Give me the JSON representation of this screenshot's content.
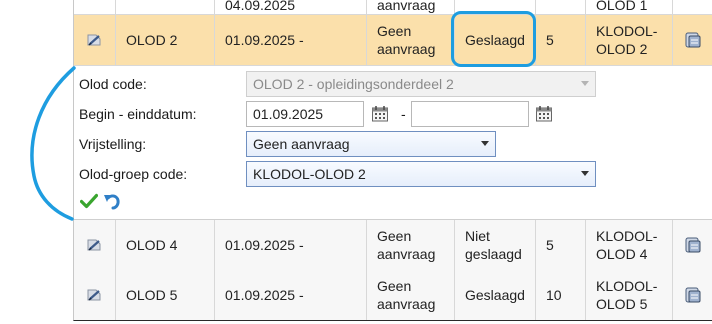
{
  "rows": [
    {
      "code": "",
      "date": "04.09.2025",
      "vrijstelling": "aanvraag",
      "status": "",
      "num": "",
      "groep": "OLOD 1"
    },
    {
      "code": "OLOD 2",
      "date": "01.09.2025 -",
      "vrijstelling": "Geen aanvraag",
      "status": "Geslaagd",
      "num": "5",
      "groep": "KLODOL-OLOD 2"
    },
    {
      "code": "OLOD 4",
      "date": "01.09.2025 -",
      "vrijstelling": "Geen aanvraag",
      "status": "Niet geslaagd",
      "num": "5",
      "groep": "KLODOL-OLOD 4"
    },
    {
      "code": "OLOD 5",
      "date": "01.09.2025 -",
      "vrijstelling": "Geen aanvraag",
      "status": "Geslaagd",
      "num": "10",
      "groep": "KLODOL-OLOD 5"
    }
  ],
  "form": {
    "olod_code_label": "Olod code:",
    "olod_code_value": "OLOD 2 - opleidingsonderdeel 2",
    "dates_label": "Begin - einddatum:",
    "begin_date": "01.09.2025",
    "date_separator": "-",
    "end_date": "",
    "vrijstelling_label": "Vrijstelling:",
    "vrijstelling_value": "Geen aanvraag",
    "groep_label": "Olod-groep code:",
    "groep_value": "KLODOL-OLOD 2"
  },
  "colors": {
    "selected_row": "#fbe0ab",
    "annotation": "#1e9de0",
    "save_icon": "#3aa52f",
    "undo_icon": "#2f7fc7"
  },
  "icons": {
    "edit": "pencil-icon",
    "details": "details-icon",
    "calendar": "calendar-icon",
    "save": "checkmark-icon",
    "undo": "undo-icon"
  }
}
